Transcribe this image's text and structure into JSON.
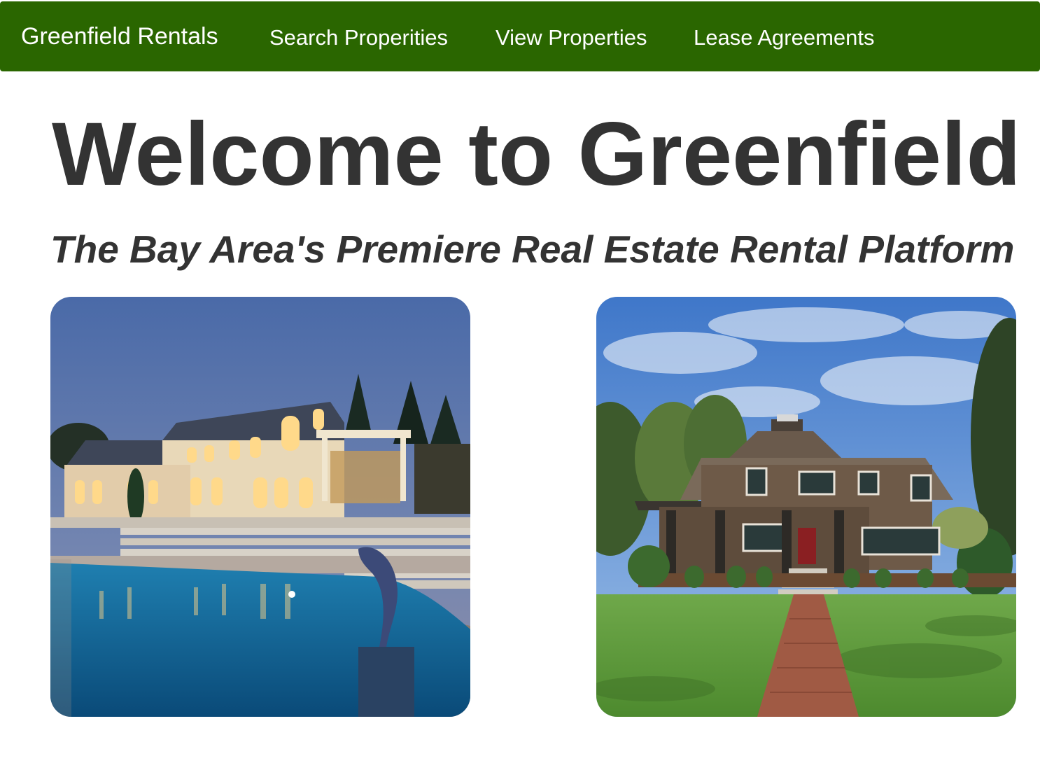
{
  "navbar": {
    "brand": "Greenfield Rentals",
    "links": [
      {
        "label": "Search Properities"
      },
      {
        "label": "View Properties"
      },
      {
        "label": "Lease Agreements"
      }
    ],
    "background_color": "#2a6600"
  },
  "hero": {
    "title": "Welcome to Greenfield Rentals",
    "subtitle": "The Bay Area's Premiere Real Estate Rental Platform"
  },
  "properties": [
    {
      "image": "luxury-mansion-pool-dusk-photo"
    },
    {
      "image": "craftsman-house-lawn-photo"
    }
  ]
}
